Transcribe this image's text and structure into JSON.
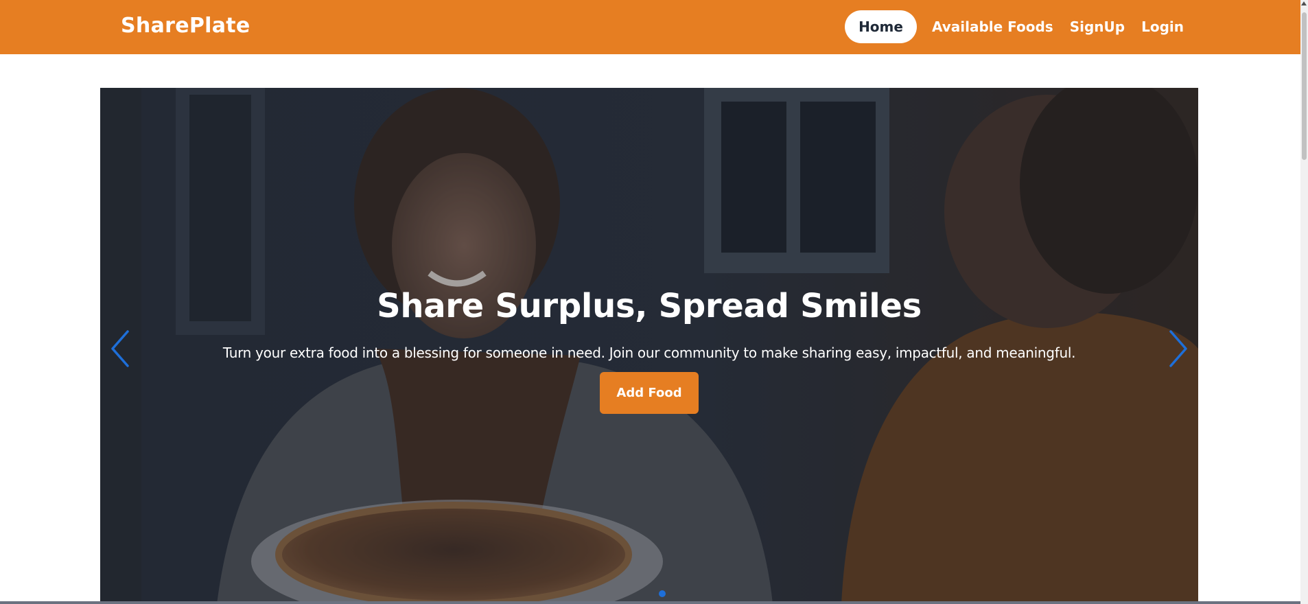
{
  "brand": "SharePlate",
  "nav": {
    "items": [
      {
        "label": "Home",
        "active": true
      },
      {
        "label": "Available Foods",
        "active": false
      },
      {
        "label": "SignUp",
        "active": false
      },
      {
        "label": "Login",
        "active": false
      }
    ]
  },
  "hero": {
    "title": "Share Surplus, Spread Smiles",
    "subtitle": "Turn your extra food into a blessing for someone in need. Join our community to make sharing easy, impactful, and meaningful.",
    "cta_label": "Add Food",
    "prev_icon": "chevron-left-icon",
    "next_icon": "chevron-right-icon"
  },
  "colors": {
    "accent": "#e67e22",
    "nav_active_bg": "#ffffff",
    "arrow": "#1e6fd9"
  }
}
